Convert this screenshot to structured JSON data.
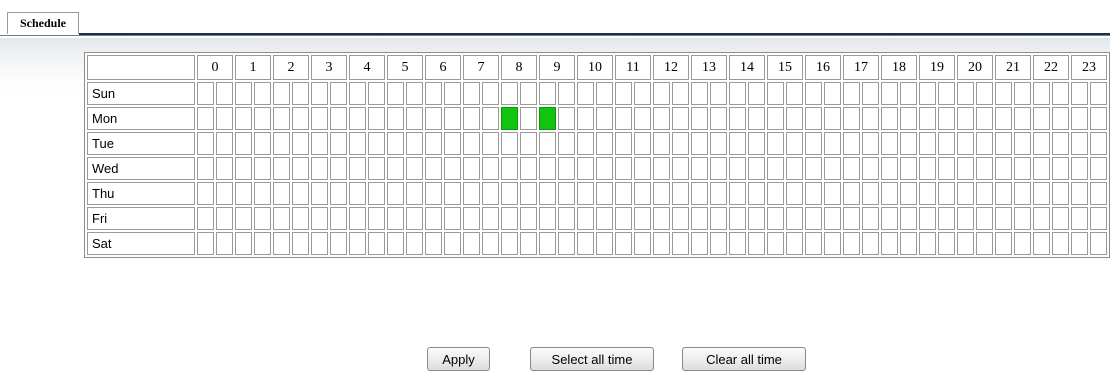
{
  "tabs": [
    {
      "label": "Schedule"
    }
  ],
  "hours": [
    "0",
    "1",
    "2",
    "3",
    "4",
    "5",
    "6",
    "7",
    "8",
    "9",
    "10",
    "11",
    "12",
    "13",
    "14",
    "15",
    "16",
    "17",
    "18",
    "19",
    "20",
    "21",
    "22",
    "23"
  ],
  "days": [
    "Sun",
    "Mon",
    "Tue",
    "Wed",
    "Thu",
    "Fri",
    "Sat"
  ],
  "slots_per_hour": 2,
  "selected_slots": [
    {
      "day": "Mon",
      "from_hour": 8,
      "to_hour": 9
    }
  ],
  "buttons": {
    "apply": "Apply",
    "select_all": "Select all time",
    "clear_all": "Clear all time"
  },
  "colors": {
    "selected": "#10c410",
    "grid_border": "#9a9a9a",
    "tab_underline": "#1f2f45"
  }
}
